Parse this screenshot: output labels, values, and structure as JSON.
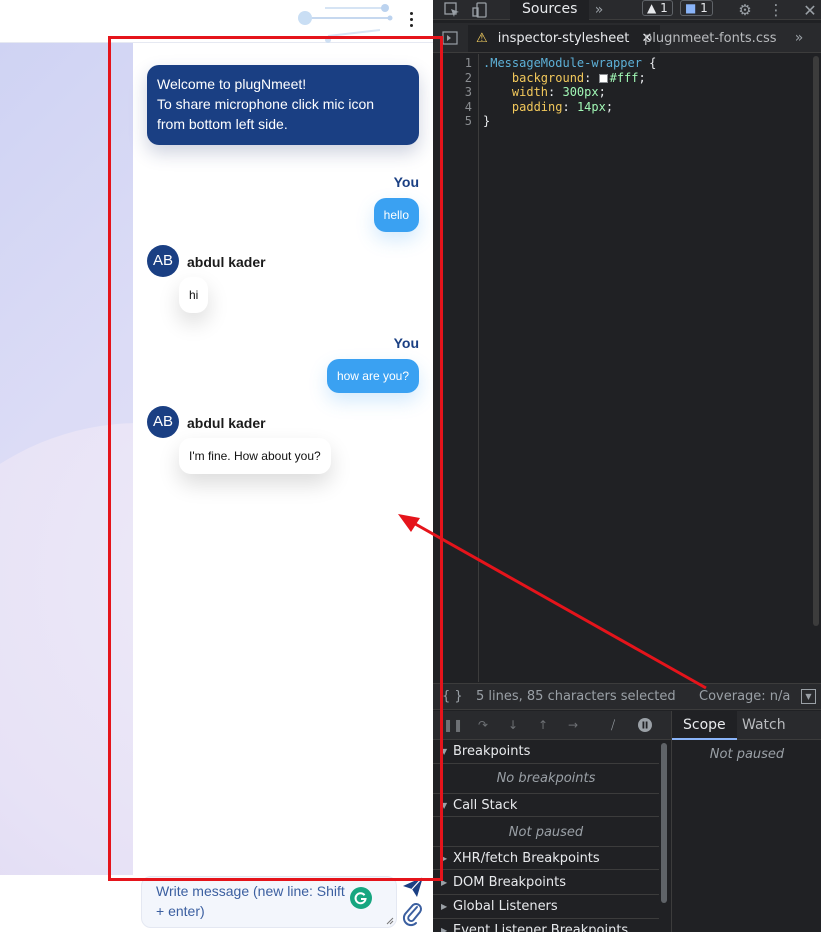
{
  "chat": {
    "welcome": {
      "line1": "Welcome to plugNmeet!",
      "line2": "To share microphone click mic icon",
      "line3": "from bottom left side."
    },
    "messages": [
      {
        "from": "You",
        "text": "hello"
      },
      {
        "from": "abdul kader",
        "initials": "AB",
        "text": "hi"
      },
      {
        "from": "You",
        "text": "how are you?"
      },
      {
        "from": "abdul kader",
        "initials": "AB",
        "text": "I'm fine. How about you?"
      }
    ],
    "composer": {
      "placeholder": "Write message (new line: Shift + enter)"
    }
  },
  "devtools": {
    "panel_tab": "Sources",
    "warnings_count": "1",
    "messages_count": "1",
    "file_tabs": [
      {
        "label": "inspector-stylesheet",
        "active": true
      },
      {
        "label": "plugnmeet-fonts.css",
        "active": false
      }
    ],
    "code": {
      "line_numbers": [
        "1",
        "2",
        "3",
        "4",
        "5"
      ],
      "selector": ".MessageModule-wrapper",
      "open_brace": " {",
      "prop1": "background",
      "val1": "#fff",
      "prop2": "width",
      "val2": "300px",
      "prop3": "padding",
      "val3": "14px",
      "close_brace": "}"
    },
    "status": {
      "braces": "{ }",
      "selection": "5 lines, 85 characters selected",
      "coverage": "Coverage: n/a"
    },
    "sections": {
      "breakpoints": "Breakpoints",
      "no_breakpoints": "No breakpoints",
      "call_stack": "Call Stack",
      "not_paused": "Not paused",
      "xhr": "XHR/fetch Breakpoints",
      "dom": "DOM Breakpoints",
      "global": "Global Listeners",
      "event": "Event Listener Breakpoints"
    },
    "right_tabs": {
      "scope": "Scope",
      "watch": "Watch"
    },
    "right_message": "Not paused"
  },
  "colors": {
    "brand_navy": "#1a3f83",
    "bubble_blue": "#3aa1f2",
    "annotation_red": "#e5141b",
    "devtools_bg": "#202124"
  }
}
